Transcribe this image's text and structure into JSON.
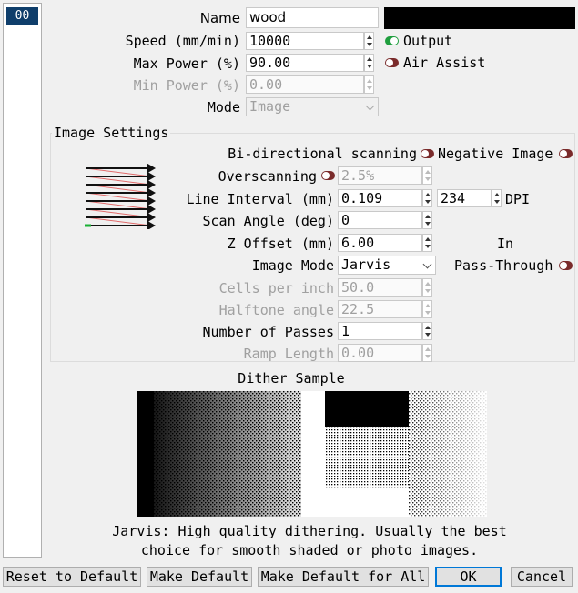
{
  "sidebar": {
    "items": [
      {
        "label": "00"
      }
    ]
  },
  "form": {
    "name": {
      "label": "Name",
      "value": "wood",
      "color_swatch": "#000000"
    },
    "speed": {
      "label": "Speed (mm/min)",
      "value": "10000"
    },
    "max_power": {
      "label": "Max Power (%)",
      "value": "90.00"
    },
    "min_power": {
      "label": "Min Power (%)",
      "value": "0.00"
    },
    "mode": {
      "label": "Mode",
      "value": "Image"
    },
    "output": {
      "label": "Output",
      "state": "on"
    },
    "air_assist": {
      "label": "Air Assist",
      "state": "off"
    }
  },
  "image_settings": {
    "title": "Image Settings",
    "bidirectional": {
      "label": "Bi-directional scanning",
      "state": "off"
    },
    "negative_image": {
      "label": "Negative Image",
      "state": "off"
    },
    "overscanning": {
      "label": "Overscanning",
      "state": "off",
      "value": "2.5%"
    },
    "line_interval": {
      "label": "Line Interval (mm)",
      "value": "0.109",
      "dpi_value": "234",
      "dpi_label": "DPI"
    },
    "scan_angle": {
      "label": "Scan Angle (deg)",
      "value": "0"
    },
    "z_offset": {
      "label": "Z Offset (mm)",
      "value": "6.00"
    },
    "in_pass_through": {
      "label_line1": "In",
      "label_line2": "Pass-Through",
      "state": "off"
    },
    "image_mode": {
      "label": "Image Mode",
      "value": "Jarvis"
    },
    "cells_per_inch": {
      "label": "Cells per inch",
      "value": "50.0"
    },
    "halftone_angle": {
      "label": "Halftone angle",
      "value": "22.5"
    },
    "passes": {
      "label": "Number of Passes",
      "value": "1"
    },
    "ramp_length": {
      "label": "Ramp Length",
      "value": "0.00"
    }
  },
  "dither": {
    "title": "Dither Sample",
    "description_line1": "Jarvis: High quality dithering. Usually the best",
    "description_line2": "choice for smooth shaded or photo images."
  },
  "buttons": {
    "reset": "Reset to Default",
    "make_default": "Make Default",
    "make_default_all": "Make Default for All",
    "ok": "OK",
    "cancel": "Cancel"
  },
  "colors": {
    "toggle_off": "#7a2b2b",
    "toggle_on": "#1f9e3e",
    "selection": "#0f3e6b"
  }
}
